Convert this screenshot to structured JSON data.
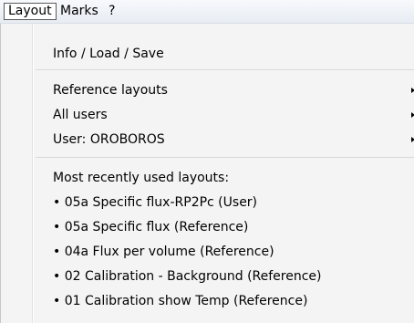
{
  "menubar": {
    "layout_label": "Layout",
    "marks_label": "Marks",
    "help_label": "?"
  },
  "menu": {
    "info_load_save": "Info / Load / Save",
    "submenus": [
      {
        "label": "Reference layouts"
      },
      {
        "label": "All users"
      },
      {
        "label": "User: OROBOROS"
      }
    ],
    "recent_header": "Most recently used layouts:",
    "recent": [
      {
        "label": "• 05a Specific flux-RP2Pc (User)"
      },
      {
        "label": "• 05a Specific flux (Reference)"
      },
      {
        "label": "• 04a Flux per volume (Reference)"
      },
      {
        "label": "• 02 Calibration - Background (Reference)"
      },
      {
        "label": "• 01 Calibration show Temp (Reference)"
      }
    ]
  }
}
